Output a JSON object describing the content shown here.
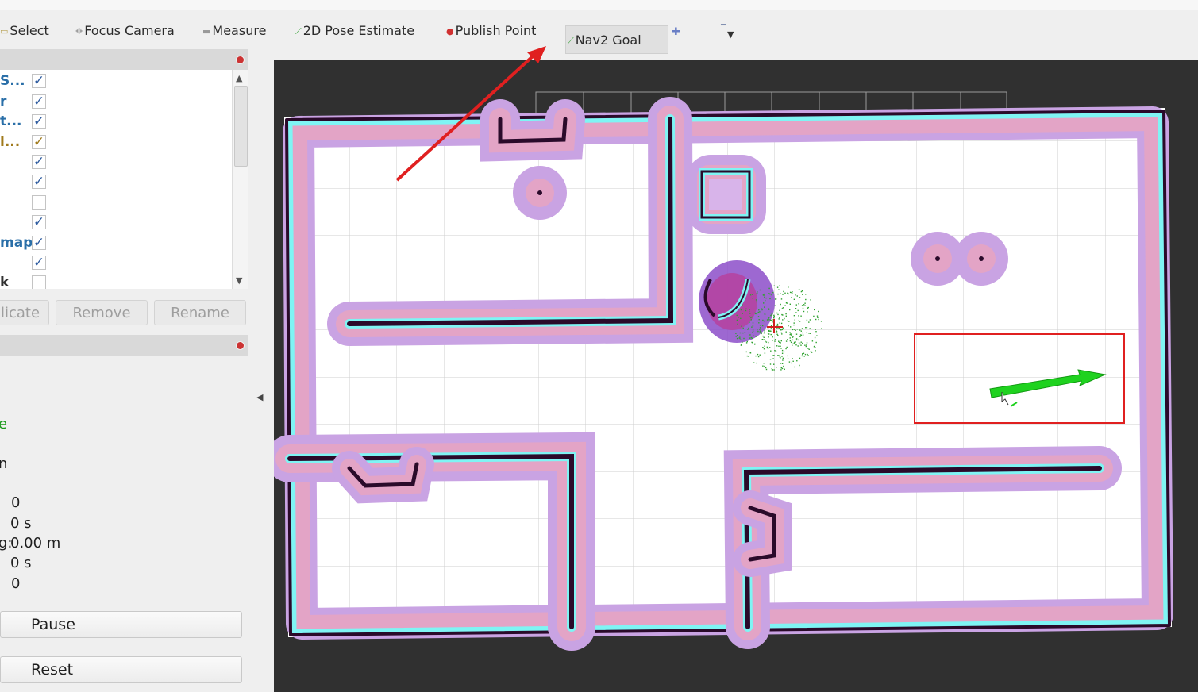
{
  "toolbar": {
    "items": [
      {
        "label": "Select",
        "icon": "select-icon"
      },
      {
        "label": "Focus Camera",
        "icon": "focus-camera-icon"
      },
      {
        "label": "Measure",
        "icon": "measure-icon"
      },
      {
        "label": "2D Pose Estimate",
        "icon": "pose-estimate-icon"
      },
      {
        "label": "Publish Point",
        "icon": "publish-point-icon"
      },
      {
        "label": "Nav2 Goal",
        "icon": "nav2-goal-icon",
        "active": true
      }
    ],
    "add_icon": "plus-icon",
    "more_icon": "dropdown-icon"
  },
  "displays": {
    "items": [
      {
        "label": "S...",
        "checked": true
      },
      {
        "label": "r",
        "checked": true
      },
      {
        "label": "t...",
        "checked": true
      },
      {
        "label": "l...",
        "checked": true
      },
      {
        "label": "",
        "checked": true
      },
      {
        "label": "",
        "checked": true
      },
      {
        "label": "",
        "checked": false
      },
      {
        "label": "",
        "checked": true
      },
      {
        "label": "map",
        "checked": true
      },
      {
        "label": "",
        "checked": true
      },
      {
        "label": "k",
        "checked": false
      }
    ],
    "buttons": {
      "duplicate": "licate",
      "remove": "Remove",
      "rename": "Rename"
    }
  },
  "nav_panel": {
    "state": "e",
    "state_color": "#1a9a1a",
    "mode": "n",
    "rows": [
      {
        "label": "",
        "value": "0"
      },
      {
        "label": "",
        "value": "0 s"
      },
      {
        "label": "g:",
        "value": "0.00 m"
      },
      {
        "label": "",
        "value": "0 s"
      },
      {
        "label": "",
        "value": "0"
      }
    ],
    "pause": "Pause",
    "reset": "Reset"
  },
  "colors": {
    "viewport_bg": "#303030",
    "costmap_inflation": "#c9a3e3",
    "costmap_core": "#e3a4c6",
    "lethal": "#2a0a2a",
    "inscribed": "#7ff4f4",
    "goal_arrow": "#1fd21f",
    "annotation": "#e02020",
    "link_blue": "#2a6fa8"
  }
}
